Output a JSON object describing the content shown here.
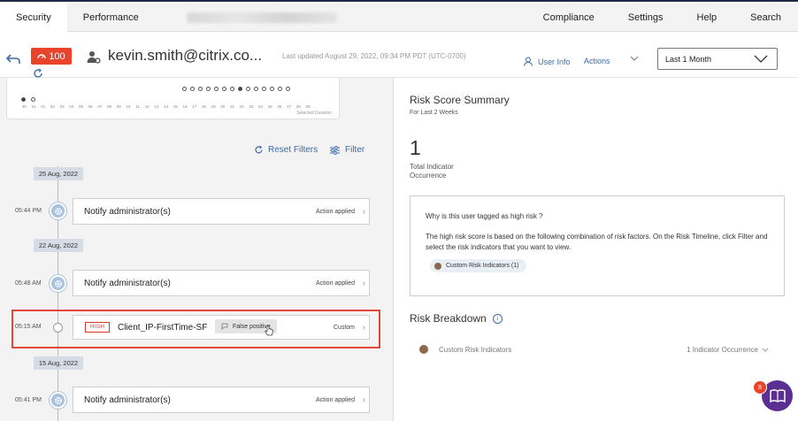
{
  "topnav": {
    "tabs": [
      "Security",
      "Performance"
    ],
    "right_links": [
      "Compliance",
      "Settings",
      "Help",
      "Search"
    ]
  },
  "header": {
    "risk_score": "100",
    "username": "kevin.smith@citrix.co...",
    "last_updated": "Last updated August 29, 2022, 09:34 PM PDT (UTC-0700)",
    "user_info_label": "User Info",
    "actions_label": "Actions",
    "period_select": "Last 1 Month"
  },
  "minichart": {
    "tick_labels": [
      "30",
      "31",
      "01",
      "02",
      "03",
      "04",
      "05",
      "06",
      "07",
      "08",
      "09",
      "10",
      "11",
      "12",
      "13",
      "14",
      "15",
      "16",
      "17",
      "18",
      "19",
      "20",
      "21",
      "22",
      "23",
      "24",
      "25",
      "26",
      "27",
      "28",
      "29"
    ],
    "selected_duration": "Selected Duration"
  },
  "filters": {
    "reset_label": "Reset Filters",
    "filter_label": "Filter"
  },
  "timeline": {
    "dates": [
      "25 Aug, 2022",
      "22 Aug, 2022",
      "15 Aug, 2022"
    ],
    "events": [
      {
        "time": "05:44 PM",
        "title": "Notify administrator(s)",
        "status": "Action applied"
      },
      {
        "time": "05:48 AM",
        "title": "Notify administrator(s)",
        "status": "Action applied"
      },
      {
        "time": "05:15 AM",
        "severity": "HIGH",
        "title": "Client_IP-FirstTime-SF",
        "tag": "False positive",
        "status": "Custom"
      },
      {
        "time": "05:41 PM",
        "title": "Notify administrator(s)",
        "status": "Action applied"
      }
    ]
  },
  "summary": {
    "title": "Risk Score Summary",
    "subtitle": "For Last 2 Weeks",
    "count": "1",
    "count_label": "Total Indicator Occurrence",
    "why_question": "Why is this user tagged as high risk ?",
    "why_text": "The high risk score is based on the following combination of risk factors. On the Risk Timeline, click Filter and select the risk indicators that you want to view.",
    "indicator_pill": "Custom Risk Indicators (1)",
    "indicator_color": "#8a6a4a"
  },
  "breakdown": {
    "title": "Risk Breakdown",
    "row_label": "Custom Risk Indicators",
    "row_value": "1 Indicator Occurrence"
  },
  "help": {
    "count": "8"
  },
  "colors": {
    "accent": "#3a6ba8",
    "risk": "#e8442b",
    "highlight": "#e2473a",
    "help": "#5b2e91"
  }
}
